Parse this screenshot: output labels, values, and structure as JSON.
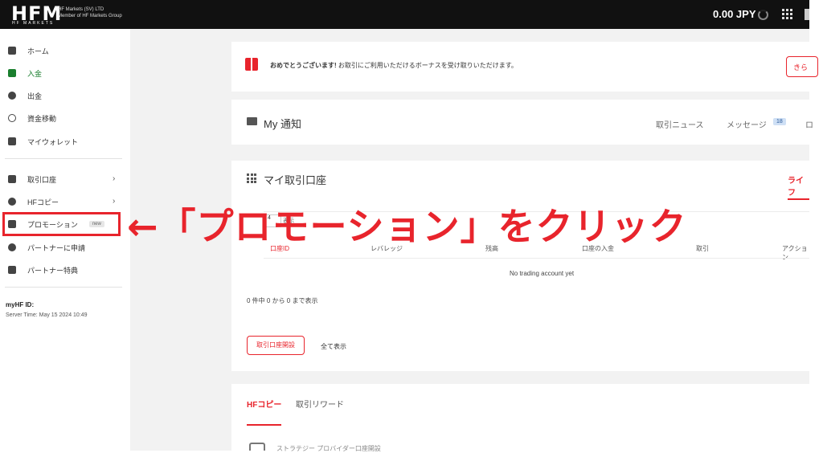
{
  "brand": {
    "logo": "HFM",
    "logo_sub": "HF MARKETS",
    "entity_line1": "HF Markets (SV) LTD",
    "entity_line2": "Member of HF Markets Group"
  },
  "header": {
    "balance": "0.00 JPY"
  },
  "sidebar": {
    "items": [
      {
        "label": "ホーム",
        "icon": "home-icon"
      },
      {
        "label": "入金",
        "icon": "deposit-icon",
        "active": true
      },
      {
        "label": "出金",
        "icon": "withdraw-icon"
      },
      {
        "label": "資金移動",
        "icon": "transfer-icon"
      },
      {
        "label": "マイウォレット",
        "icon": "wallet-icon"
      },
      {
        "label": "取引口座",
        "icon": "trading-account-icon"
      },
      {
        "label": "HFコピー",
        "icon": "copy-icon"
      },
      {
        "label": "プロモーション",
        "icon": "promotion-icon",
        "badge": "new"
      },
      {
        "label": "パートナーに申請",
        "icon": "user-icon"
      },
      {
        "label": "パートナー特典",
        "icon": "partner-benefit-icon"
      }
    ],
    "myhf_label": "myHF ID:",
    "server_time": "Server Time: May 15 2024 10:49"
  },
  "bonus_card": {
    "text_bold": "おめでとうございます!",
    "text": " お取引にご利用いただけるボーナスを受け取りいただけます。",
    "button": "きら"
  },
  "notice_card": {
    "title": "My 通知",
    "tabs": [
      "取引ニュース",
      "メッセージ"
    ],
    "message_count": "18",
    "edge_tab": "ロ"
  },
  "accounts_card": {
    "title": "マイ取引口座",
    "live_tab": "ライフ",
    "show_value": "4",
    "show_label": "表示",
    "columns": [
      "口座ID",
      "レバレッジ",
      "残高",
      "口座の入金",
      "取引",
      "アクション"
    ],
    "empty_text": "No trading account yet",
    "entries_text": "0 件中 0 から 0 まで表示",
    "open_button": "取引口座開設",
    "show_all": "全て表示"
  },
  "copy_card": {
    "tabs": [
      "HFコピー",
      "取引リワード"
    ],
    "partial_text": "ストラテジー プロバイダー口座開設"
  },
  "annotation": {
    "text": "←「プロモーション」をクリック"
  },
  "colors": {
    "accent": "#e8242c",
    "active_green": "#1a7f2e",
    "topbar": "#111111"
  }
}
